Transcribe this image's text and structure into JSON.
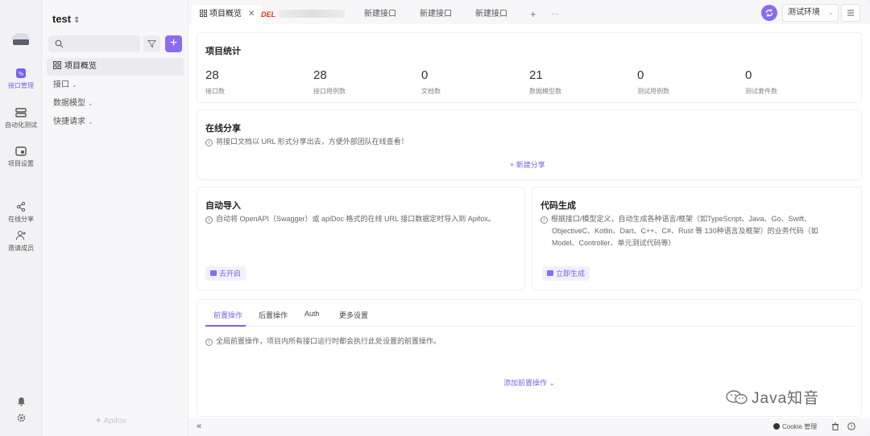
{
  "rail": {
    "items": [
      {
        "label": "接口管理",
        "icon": "api-icon",
        "active": true
      },
      {
        "label": "自动化测试",
        "icon": "layers-icon",
        "active": false
      },
      {
        "label": "项目设置",
        "icon": "settings-card-icon",
        "active": false
      },
      {
        "label": "在线分享",
        "icon": "share-icon",
        "active": false
      },
      {
        "label": "邀请成员",
        "icon": "add-user-icon",
        "active": false
      }
    ]
  },
  "sidebar": {
    "project_name": "test",
    "search": {
      "placeholder": "",
      "value": ""
    },
    "tree": [
      {
        "label": "项目概览",
        "active": true
      },
      {
        "label": "接口",
        "active": false
      },
      {
        "label": "数据模型",
        "active": false
      },
      {
        "label": "快捷请求",
        "active": false
      }
    ],
    "brand": "Apifox"
  },
  "tabs": [
    {
      "label": "项目概览",
      "active": true,
      "closable": true
    },
    {
      "label": "DEL",
      "active": false
    },
    {
      "label": "新建接口",
      "active": false
    },
    {
      "label": "新建接口",
      "active": false
    },
    {
      "label": "新建接口",
      "active": false
    }
  ],
  "tab_tools": {
    "add": "+",
    "more": "···"
  },
  "environment": {
    "selected": "测试环境"
  },
  "stats": {
    "title": "项目统计",
    "items": [
      {
        "value": "28",
        "label": "接口数"
      },
      {
        "value": "28",
        "label": "接口用例数"
      },
      {
        "value": "0",
        "label": "文档数"
      },
      {
        "value": "21",
        "label": "数据模型数"
      },
      {
        "value": "0",
        "label": "测试用例数"
      },
      {
        "value": "0",
        "label": "测试套件数"
      }
    ]
  },
  "share": {
    "title": "在线分享",
    "hint": "将接口文档以 URL 形式分享出去，方便外部团队在线查看！",
    "action": "+ 新建分享"
  },
  "auto_import": {
    "title": "自动导入",
    "hint": "自动将 OpenAPI（Swagger）或 apiDoc 格式的在线 URL 接口数据定时导入到 Apifox。",
    "action": "去开启"
  },
  "codegen": {
    "title": "代码生成",
    "hint_line1": "根据接口/模型定义，自动生成各种语言/框架（如TypeScript、Java、Go、Swift、",
    "hint_line2": "ObjectiveC、Kotlin、Dart、C++、C#、Rust 等 130种语言及框架）的业务代码（如",
    "hint_line3": "Model、Controller、单元测试代码等）",
    "action": "立即生成"
  },
  "ops": {
    "tabs": [
      "前置操作",
      "后置操作",
      "Auth",
      "更多设置"
    ],
    "hint": "全局前置操作，项目内所有接口运行时都会执行此处设置的前置操作。",
    "action": "添加前置操作"
  },
  "statusbar": {
    "collapse": "«",
    "cookie": "Cookie 管理"
  },
  "watermark": "Java知音"
}
